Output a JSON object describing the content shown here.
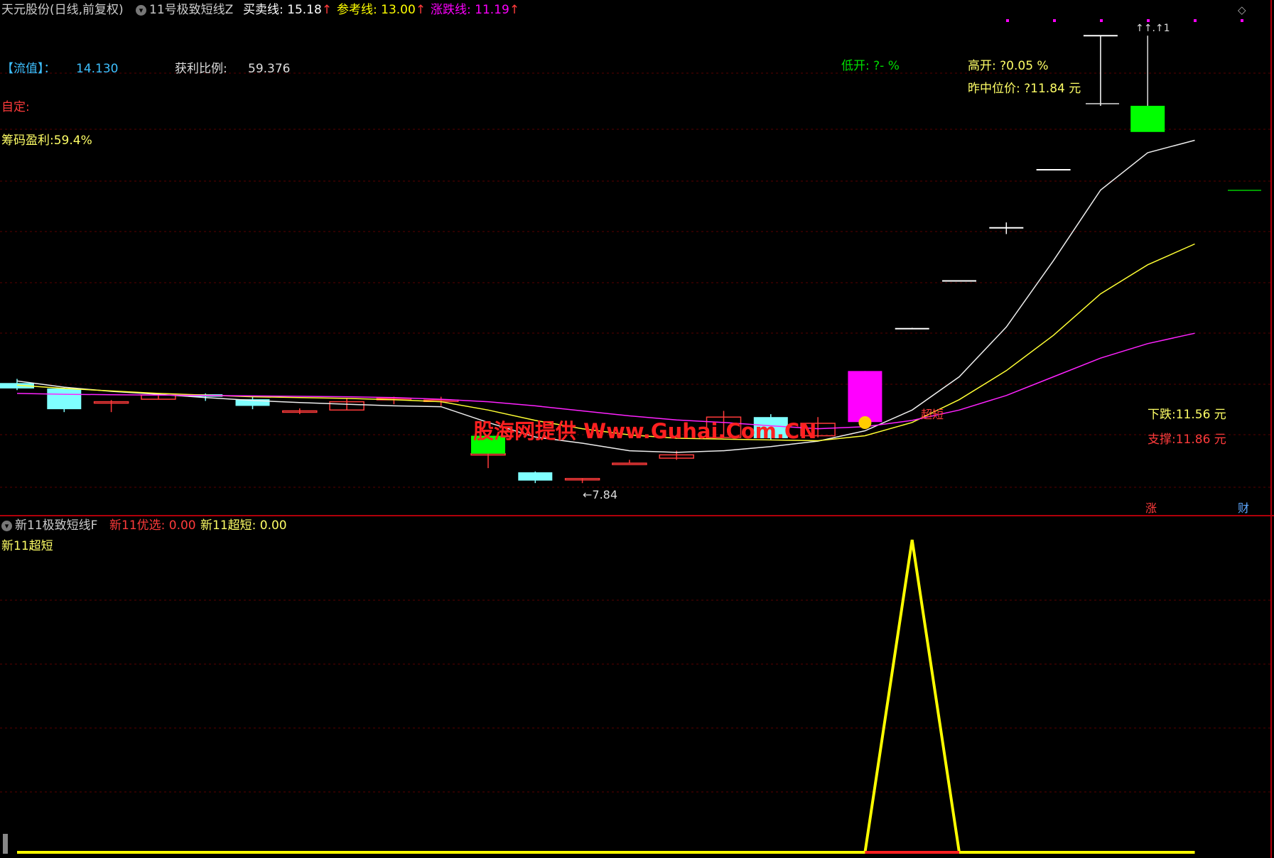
{
  "colors": {
    "up": "#ff3b3b",
    "down": "#7fffff",
    "green_block": "#00ff00",
    "magenta": "#ff00ff",
    "yellow": "#ffff00",
    "white": "#ffffff",
    "bg": "#000000",
    "panel_border": "#b0000a",
    "grid": "#5a0000"
  },
  "header": {
    "stock": "天元股份(日线,前复权)",
    "indicator": "11号极致短线Z",
    "buy_sell_label": "买卖线: 15.18",
    "ref_label": "参考线: 13.00",
    "updown_label": "涨跌线: 11.19",
    "arrow": "↑",
    "diamond_icon": "diamond-icon"
  },
  "info": {
    "liuzhi_label": "【流值】：",
    "liuzhi_value": "14.130",
    "profit_ratio_label": "获利比例:",
    "profit_ratio_value": "59.376",
    "custom_label": "自定:",
    "chip_profit": "筹码盈利:59.4%",
    "low_open": "低开: ?- %",
    "high_open": "高开: ?0.05 %",
    "prev_mid": "昨中位价: ?11.84 元",
    "down_label": "下跌:11.56 元",
    "support_label": "支撑:11.86 元",
    "low_price_mark": "←7.84",
    "high_mark": "↑↑.↑1",
    "super_short_tag": "超短",
    "zhang_tag": "涨",
    "cai_tag": "财"
  },
  "watermark": "股海网提供 Www.Guhai.Com.CN",
  "sub_panel": {
    "title": "新11极致短线F",
    "youxuan": "新11优选: 0.00",
    "chaoduan": "新11超短: 0.00",
    "series_label": "新11超短"
  },
  "chart_data": [
    {
      "type": "candlestick",
      "title": "",
      "candles": [
        {
          "o": 10.25,
          "h": 10.35,
          "l": 10.08,
          "c": 10.12
        },
        {
          "o": 10.12,
          "h": 10.14,
          "l": 9.55,
          "c": 9.62
        },
        {
          "o": 9.8,
          "h": 9.84,
          "l": 9.55,
          "c": 9.8
        },
        {
          "o": 9.86,
          "h": 10.0,
          "l": 9.86,
          "c": 9.96
        },
        {
          "o": 9.98,
          "h": 10.0,
          "l": 9.82,
          "c": 9.92
        },
        {
          "o": 9.86,
          "h": 9.92,
          "l": 9.62,
          "c": 9.7
        },
        {
          "o": 9.58,
          "h": 9.64,
          "l": 9.5,
          "c": 9.58
        },
        {
          "o": 9.6,
          "h": 9.88,
          "l": 9.6,
          "c": 9.8
        },
        {
          "o": 9.86,
          "h": 9.92,
          "l": 9.74,
          "c": 9.88
        },
        {
          "o": 9.84,
          "h": 9.92,
          "l": 9.7,
          "c": 9.84
        },
        {
          "o": 8.55,
          "h": 8.62,
          "l": 8.2,
          "c": 8.55
        },
        {
          "o": 8.1,
          "h": 8.12,
          "l": 7.84,
          "c": 7.9
        },
        {
          "o": 7.95,
          "h": 7.95,
          "l": 7.84,
          "c": 7.95
        },
        {
          "o": 8.32,
          "h": 8.4,
          "l": 8.32,
          "c": 8.32
        },
        {
          "o": 8.44,
          "h": 8.62,
          "l": 8.4,
          "c": 8.52
        },
        {
          "o": 8.94,
          "h": 9.58,
          "l": 8.94,
          "c": 9.43
        },
        {
          "o": 9.43,
          "h": 9.5,
          "l": 8.88,
          "c": 8.92
        },
        {
          "o": 8.98,
          "h": 9.43,
          "l": 8.94,
          "c": 9.28
        },
        {
          "o": 9.31,
          "h": 10.54,
          "l": 9.31,
          "c": 10.54
        },
        {
          "o": 11.56,
          "h": 11.58,
          "l": 11.56,
          "c": 11.56
        },
        {
          "o": 12.71,
          "h": 12.71,
          "l": 12.71,
          "c": 12.71
        },
        {
          "o": 13.99,
          "h": 14.12,
          "l": 13.84,
          "c": 13.99
        },
        {
          "o": 15.39,
          "h": 15.39,
          "l": 15.39,
          "c": 15.39
        },
        {
          "o": 16.93,
          "h": 18.62,
          "l": 16.93,
          "c": 18.62
        },
        {
          "o": 16.93,
          "h": 18.62,
          "l": 16.93,
          "c": 16.93
        }
      ],
      "green_blocks": [
        {
          "i": 10,
          "top": 8.98,
          "bottom": 8.55
        },
        {
          "i": 24,
          "top": 16.93,
          "bottom": 16.3
        }
      ],
      "lines": [
        {
          "name": "white",
          "values": [
            10.3,
            10.15,
            10.05,
            9.98,
            9.9,
            9.83,
            9.78,
            9.74,
            9.7,
            9.68,
            9.3,
            8.95,
            8.8,
            8.62,
            8.58,
            8.62,
            8.72,
            8.85,
            9.1,
            9.6,
            10.4,
            11.6,
            13.2,
            14.9,
            15.8,
            16.1
          ]
        },
        {
          "name": "yellow",
          "values": [
            10.2,
            10.12,
            10.06,
            10.0,
            9.96,
            9.92,
            9.9,
            9.88,
            9.85,
            9.8,
            9.6,
            9.35,
            9.15,
            9.0,
            8.92,
            8.9,
            8.88,
            8.86,
            8.98,
            9.3,
            9.85,
            10.55,
            11.4,
            12.4,
            13.1,
            13.6
          ]
        },
        {
          "name": "magenta",
          "values": [
            10.0,
            9.98,
            9.97,
            9.96,
            9.95,
            9.94,
            9.93,
            9.92,
            9.9,
            9.86,
            9.8,
            9.7,
            9.58,
            9.46,
            9.36,
            9.3,
            9.22,
            9.15,
            9.2,
            9.35,
            9.6,
            9.95,
            10.4,
            10.85,
            11.2,
            11.45
          ]
        }
      ],
      "price_range": [
        7.5,
        19.0
      ],
      "grid": true
    },
    {
      "type": "line",
      "title": "",
      "series": [
        {
          "name": "新11超短",
          "values": [
            0,
            0,
            0,
            0,
            0,
            0,
            0,
            0,
            0,
            0,
            0,
            0,
            0,
            0,
            0,
            0,
            0,
            0,
            0,
            1,
            0,
            0,
            0,
            0,
            0,
            0
          ]
        }
      ],
      "ylim": [
        0,
        1.0
      ],
      "grid": true
    }
  ]
}
